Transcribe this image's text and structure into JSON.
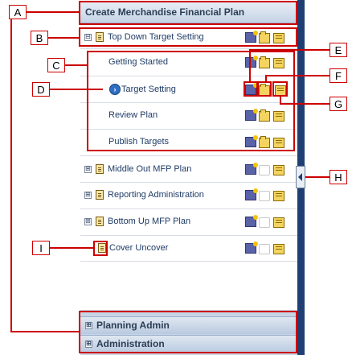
{
  "panel": {
    "title": "Create Merchandise Financial Plan",
    "sections": [
      {
        "label": "Top Down Target Setting",
        "expanded": true,
        "toggle": "⊟"
      },
      {
        "label": "Middle Out MFP Plan",
        "toggle": "⊞"
      },
      {
        "label": "Reporting Administration",
        "toggle": "⊞"
      },
      {
        "label": "Bottom Up MFP Plan",
        "toggle": "⊞"
      },
      {
        "label": "Cover Uncover"
      }
    ],
    "steps": [
      {
        "label": "Getting Started"
      },
      {
        "label": "Target Setting",
        "current": true
      },
      {
        "label": "Review Plan"
      },
      {
        "label": "Publish Targets"
      }
    ],
    "bottom": [
      {
        "label": "Planning Admin",
        "toggle": "⊞"
      },
      {
        "label": "Administration",
        "toggle": "⊞"
      }
    ]
  },
  "callouts": [
    "A",
    "B",
    "C",
    "D",
    "E",
    "F",
    "G",
    "H",
    "I"
  ],
  "colors": {
    "accent": "#cc0000",
    "dark_bar": "#1f3f74",
    "link": "#1f3b66"
  }
}
